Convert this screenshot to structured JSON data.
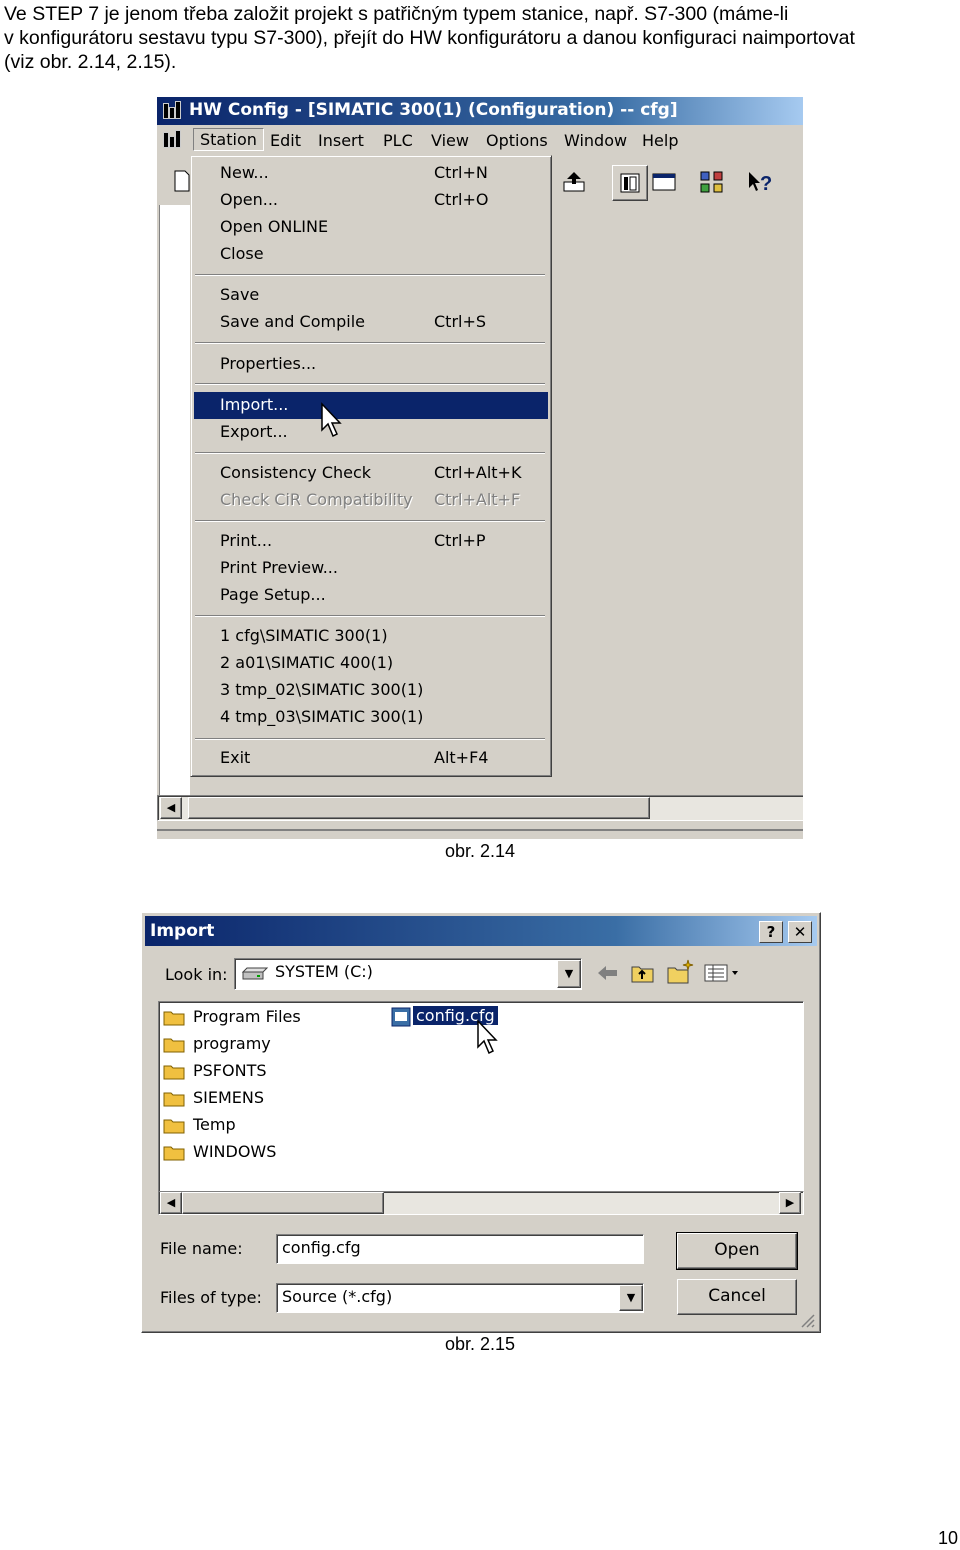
{
  "intro": {
    "line1": "Ve STEP 7 je jenom třeba založit projekt s patřičným typem stanice, např. S7-300 (máme-li",
    "line2": "v konfigurátoru sestavu typu S7-300), přejít do HW konfigurátoru a danou konfiguraci naimportovat",
    "line3": "(viz obr. 2.14, 2.15)."
  },
  "fig1": {
    "title": "HW Config - [SIMATIC 300(1) (Configuration) -- cfg]",
    "menubar": [
      "Station",
      "Edit",
      "Insert",
      "PLC",
      "View",
      "Options",
      "Window",
      "Help"
    ],
    "menu": [
      {
        "label": "New...",
        "shortcut": "Ctrl+N"
      },
      {
        "label": "Open...",
        "shortcut": "Ctrl+O"
      },
      {
        "label": "Open ONLINE",
        "shortcut": ""
      },
      {
        "label": "Close",
        "shortcut": ""
      },
      {
        "label": "Save",
        "shortcut": ""
      },
      {
        "label": "Save and Compile",
        "shortcut": "Ctrl+S"
      },
      {
        "label": "Properties...",
        "shortcut": ""
      },
      {
        "label": "Import...",
        "shortcut": ""
      },
      {
        "label": "Export...",
        "shortcut": ""
      },
      {
        "label": "Consistency Check",
        "shortcut": "Ctrl+Alt+K"
      },
      {
        "label": "Check CiR Compatibility",
        "shortcut": "Ctrl+Alt+F"
      },
      {
        "label": "Print...",
        "shortcut": "Ctrl+P"
      },
      {
        "label": "Print Preview...",
        "shortcut": ""
      },
      {
        "label": "Page Setup...",
        "shortcut": ""
      },
      {
        "label": "1 cfg\\SIMATIC 300(1)",
        "shortcut": ""
      },
      {
        "label": "2 a01\\SIMATIC 400(1)",
        "shortcut": ""
      },
      {
        "label": "3 tmp_02\\SIMATIC 300(1)",
        "shortcut": ""
      },
      {
        "label": "4 tmp_03\\SIMATIC 300(1)",
        "shortcut": ""
      },
      {
        "label": "Exit",
        "shortcut": "Alt+F4"
      }
    ],
    "caption": "obr. 2.14"
  },
  "fig2": {
    "title": "Import",
    "help_btn": "?",
    "close_btn": "✕",
    "look_in_label": "Look in:",
    "look_in_value": "SYSTEM (C:)",
    "folders": [
      "Program Files",
      "programy",
      "PSFONTS",
      "SIEMENS",
      "Temp",
      "WINDOWS"
    ],
    "selected_file": "config.cfg",
    "file_name_label": "File name:",
    "file_name_value": "config.cfg",
    "file_type_label": "Files of type:",
    "file_type_value": "Source (*.cfg)",
    "open_label": "Open",
    "cancel_label": "Cancel",
    "caption": "obr. 2.15"
  },
  "page_number": "10",
  "colors": {
    "titlebar_start": "#0a246a",
    "titlebar_end": "#a6caf0",
    "face": "#d4d0c8",
    "highlight": "#0a246a",
    "folder": "#f0c040"
  }
}
